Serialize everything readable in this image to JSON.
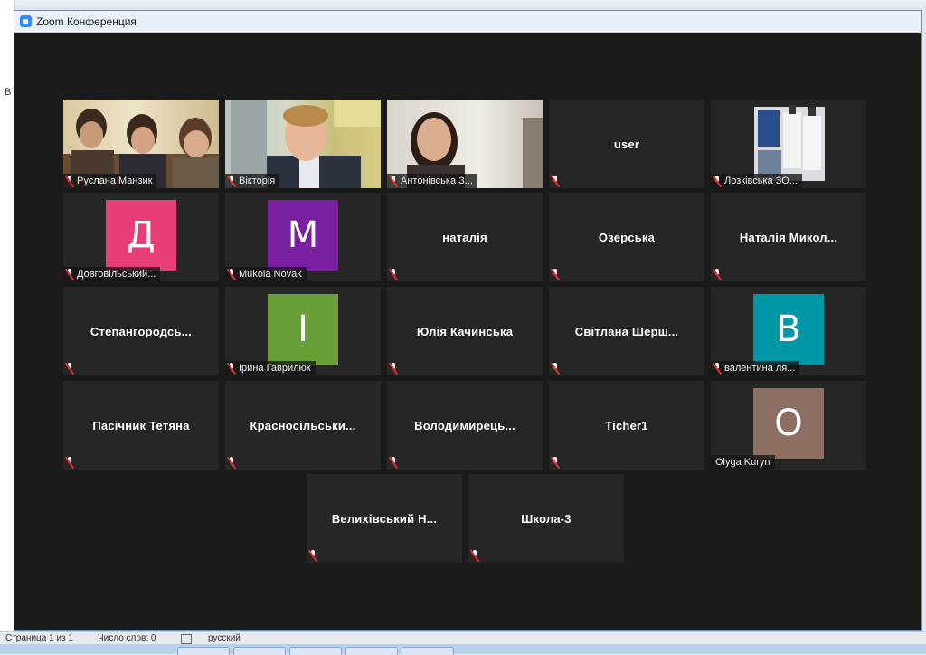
{
  "window": {
    "title": "Zoom Конференция"
  },
  "tiles": [
    {
      "name": "Руслана Манзик",
      "type": "video",
      "scene": "group-room",
      "active": true
    },
    {
      "name": "Вікторія",
      "type": "video",
      "scene": "boy-classroom"
    },
    {
      "name": "Антонівська З...",
      "type": "video",
      "scene": "girl-room"
    },
    {
      "name": "user",
      "type": "name"
    },
    {
      "name": "Лозківська ЗО...",
      "type": "video",
      "scene": "bottles"
    },
    {
      "name": "Довговільський...",
      "type": "avatar",
      "letter": "Д",
      "color": "#e83e77"
    },
    {
      "name": "Mukola Novak",
      "type": "avatar",
      "letter": "M",
      "color": "#7b1fa2"
    },
    {
      "name": "наталія",
      "type": "name"
    },
    {
      "name": "Озерська",
      "type": "name"
    },
    {
      "name": "Наталія  Микол...",
      "type": "name"
    },
    {
      "name": "Степангородсь...",
      "type": "name"
    },
    {
      "name": "Ірина Гаврилюк",
      "type": "avatar",
      "letter": "І",
      "color": "#689f38"
    },
    {
      "name": "Юлія Качинська",
      "type": "name"
    },
    {
      "name": "Світлана  Шерш...",
      "type": "name"
    },
    {
      "name": "валентина ля...",
      "type": "avatar",
      "letter": "В",
      "color": "#0097a7"
    },
    {
      "name": "Пасічник Тетяна",
      "type": "name"
    },
    {
      "name": "Красносільськи...",
      "type": "name"
    },
    {
      "name": "Володимирець...",
      "type": "name"
    },
    {
      "name": "Ticher1",
      "type": "name"
    },
    {
      "name": "Olyga Kuryn",
      "type": "avatar",
      "letter": "O",
      "color": "#8d6e63",
      "unmuted": true
    },
    {
      "name": "Велихівський  Н...",
      "type": "name"
    },
    {
      "name": "Школа-3",
      "type": "name"
    }
  ],
  "word_status": {
    "page": "Страница 1 из 1",
    "words": "Число слов: 0",
    "language": "русский"
  },
  "left_fragment": "В"
}
